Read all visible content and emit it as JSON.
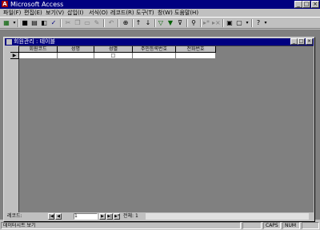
{
  "app": {
    "title": "Microsoft Access",
    "icon_letter": "A"
  },
  "window_buttons": {
    "minimize": "_",
    "maximize": "□",
    "close": "×"
  },
  "menu": [
    "파일(F)",
    "편집(E)",
    "보기(V)",
    "삽입(I)",
    "서식(O)",
    "레코드(R)",
    "도구(T)",
    "창(W)",
    "도움말(H)"
  ],
  "toolbar_icons": [
    "view-icon",
    "save-icon",
    "print-icon",
    "preview-icon",
    "spell-icon",
    "cut-icon",
    "copy-icon",
    "paste-icon",
    "format-painter-icon",
    "undo-icon",
    "hyperlink-icon",
    "sort-asc-icon",
    "sort-desc-icon",
    "filter-selection-icon",
    "filter-form-icon",
    "apply-filter-icon",
    "find-icon",
    "new-record-icon",
    "delete-record-icon",
    "database-window-icon",
    "new-object-icon",
    "help-icon"
  ],
  "table_window": {
    "title": "회원관리 : 테이블",
    "columns": [
      "회원코드",
      "성명",
      "성별",
      "주민등록번호",
      "전화번호"
    ],
    "record_selector": "▶",
    "checkbox": "□"
  },
  "navigation": {
    "label": "레코드:",
    "first": "|◀",
    "prev": "◀",
    "current": "1",
    "next": "▶",
    "last": "▶|",
    "new": "▶*",
    "total_label": "전체: 1"
  },
  "statusbar": {
    "mode": "데이터시트 보기",
    "caps": "CAPS",
    "num": "NUM"
  },
  "colors": {
    "titlebar": "#000080",
    "workspace": "#808080",
    "face": "#c0c0c0"
  }
}
